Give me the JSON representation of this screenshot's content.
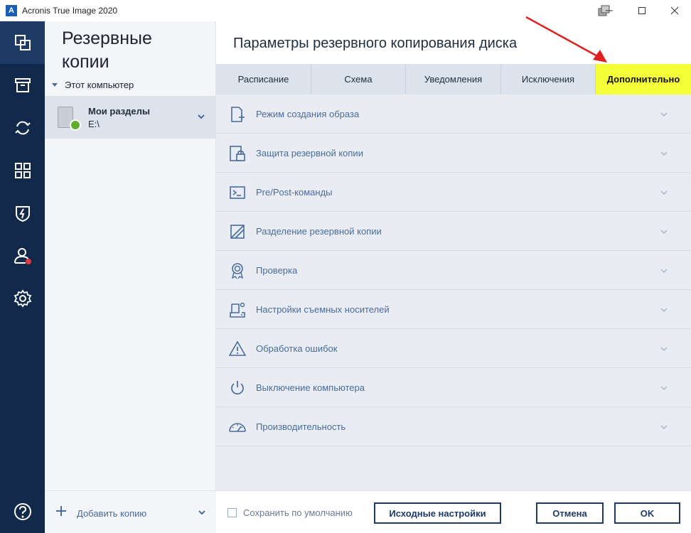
{
  "window": {
    "logo_letter": "A",
    "title": "Acronis True Image 2020"
  },
  "rail": {
    "items": [
      {
        "name": "backup-icon",
        "active": true
      },
      {
        "name": "archive-icon"
      },
      {
        "name": "sync-icon"
      },
      {
        "name": "tools-icon"
      },
      {
        "name": "protection-icon"
      },
      {
        "name": "account-icon"
      },
      {
        "name": "settings-icon"
      },
      {
        "name": "help-icon"
      }
    ]
  },
  "list": {
    "title": "Резервные копии",
    "group_label": "Этот компьютер",
    "backup": {
      "name": "Мои разделы",
      "path": "E:\\"
    },
    "add_label": "Добавить копию"
  },
  "main": {
    "title": "Параметры резервного копирования диска",
    "tabs": [
      {
        "label": "Расписание"
      },
      {
        "label": "Схема"
      },
      {
        "label": "Уведомления"
      },
      {
        "label": "Исключения"
      },
      {
        "label": "Дополнительно",
        "active": true
      }
    ],
    "options": [
      {
        "label": "Режим создания образа",
        "icon": "image-mode-icon"
      },
      {
        "label": "Защита резервной копии",
        "icon": "lock-icon"
      },
      {
        "label": "Pre/Post-команды",
        "icon": "terminal-icon"
      },
      {
        "label": "Разделение резервной копии",
        "icon": "split-icon"
      },
      {
        "label": "Проверка",
        "icon": "validation-icon"
      },
      {
        "label": "Настройки съемных носителей",
        "icon": "removable-media-icon"
      },
      {
        "label": "Обработка ошибок",
        "icon": "warning-icon"
      },
      {
        "label": "Выключение компьютера",
        "icon": "power-icon"
      },
      {
        "label": "Производительность",
        "icon": "performance-icon"
      }
    ]
  },
  "footer": {
    "save_default_label": "Сохранить по умолчанию",
    "reset_label": "Исходные настройки",
    "cancel_label": "Отмена",
    "ok_label": "OK"
  },
  "colors": {
    "rail_bg": "#13294b",
    "accent": "#4a6b9a",
    "highlight_tab": "#f4ff3a",
    "annotation_arrow": "#e02020"
  }
}
